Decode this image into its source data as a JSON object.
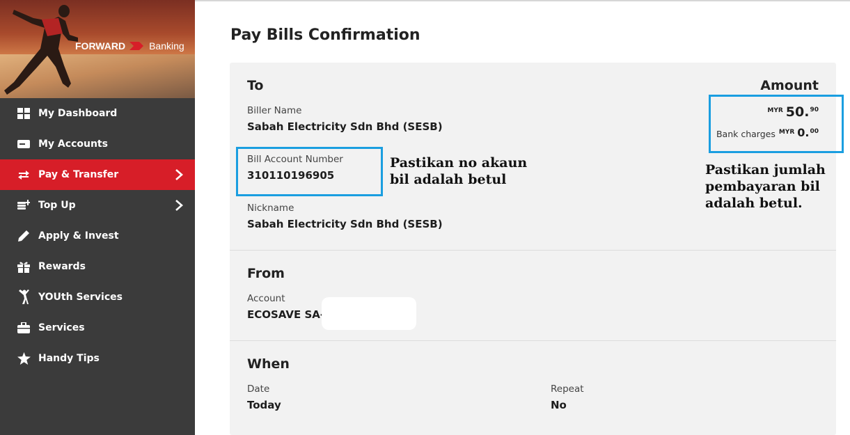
{
  "brand": {
    "forward": "FORWARD",
    "banking": "Banking",
    "accent_color": "#d71e28"
  },
  "sidebar": {
    "items": [
      {
        "label": "My Dashboard",
        "icon": "dashboard-grid-icon",
        "active": false,
        "chevron": false
      },
      {
        "label": "My Accounts",
        "icon": "wallet-icon",
        "active": false,
        "chevron": false
      },
      {
        "label": "Pay & Transfer",
        "icon": "transfer-arrows-icon",
        "active": true,
        "chevron": true
      },
      {
        "label": "Top Up",
        "icon": "coins-plus-icon",
        "active": false,
        "chevron": true
      },
      {
        "label": "Apply & Invest",
        "icon": "pen-icon",
        "active": false,
        "chevron": false
      },
      {
        "label": "Rewards",
        "icon": "gift-icon",
        "active": false,
        "chevron": false
      },
      {
        "label": "YOUth Services",
        "icon": "person-jumping-icon",
        "active": false,
        "chevron": false
      },
      {
        "label": "Services",
        "icon": "briefcase-icon",
        "active": false,
        "chevron": false
      },
      {
        "label": "Handy Tips",
        "icon": "star-icon",
        "active": false,
        "chevron": false
      }
    ]
  },
  "page": {
    "title": "Pay Bills Confirmation"
  },
  "to": {
    "heading": "To",
    "biller_label": "Biller Name",
    "biller_value": "Sabah Electricity Sdn Bhd (SESB)",
    "account_label": "Bill Account Number",
    "account_value": "310110196905",
    "nickname_label": "Nickname",
    "nickname_value": "Sabah Electricity Sdn Bhd (SESB)"
  },
  "amount": {
    "heading": "Amount",
    "currency": "MYR",
    "whole": "50.",
    "cents": "90",
    "charges_label": "Bank charges",
    "charges_currency": "MYR",
    "charges_whole": "0.",
    "charges_cents": "00"
  },
  "from": {
    "heading": "From",
    "account_label": "Account",
    "account_value": "ECOSAVE SA-i"
  },
  "when": {
    "heading": "When",
    "date_label": "Date",
    "date_value": "Today",
    "repeat_label": "Repeat",
    "repeat_value": "No"
  },
  "annotations": {
    "account_note_line1": "Pastikan no akaun",
    "account_note_line2": "bil adalah betul",
    "amount_note_line1": "Pastikan jumlah",
    "amount_note_line2": "pembayaran bil",
    "amount_note_line3": "adalah betul.",
    "highlight_color": "#1a9ee0"
  }
}
